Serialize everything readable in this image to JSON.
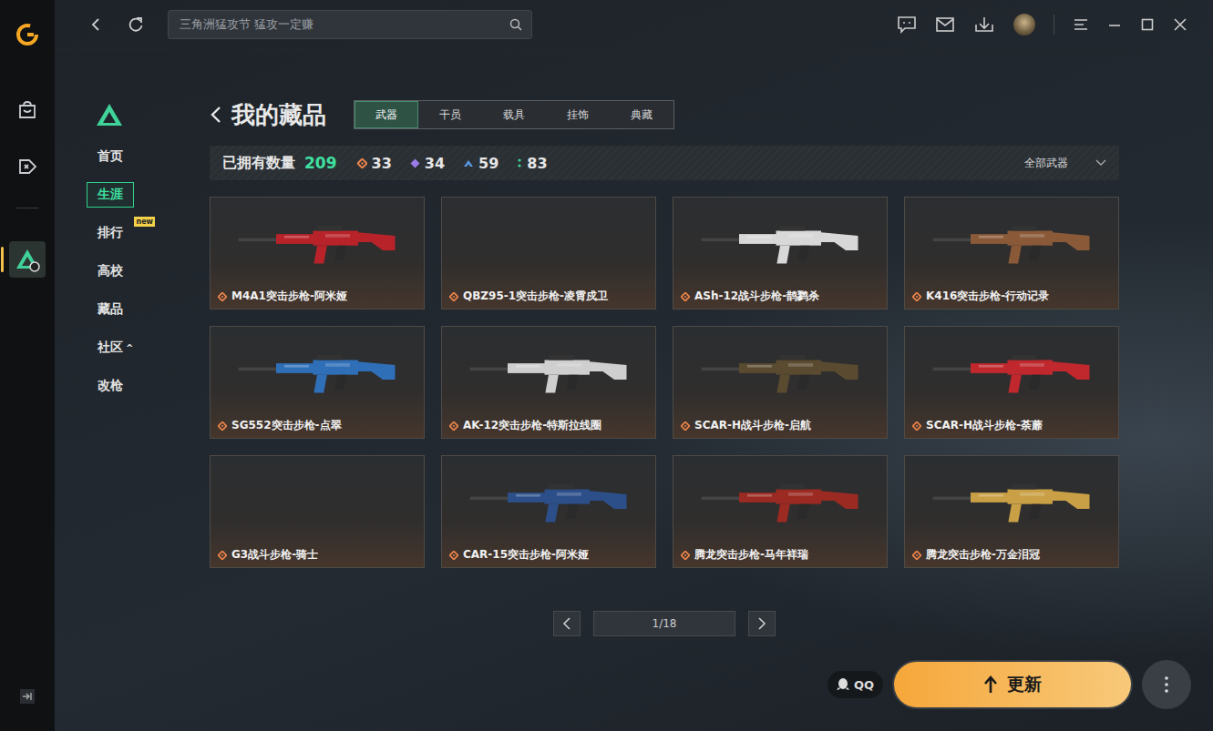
{
  "search": {
    "placeholder": "三角洲猛攻节 猛攻一定赚"
  },
  "subnav": [
    {
      "label": "首页",
      "selected": false
    },
    {
      "label": "生涯",
      "selected": true
    },
    {
      "label": "排行",
      "selected": false,
      "badge": "new"
    },
    {
      "label": "高校",
      "selected": false
    },
    {
      "label": "藏品",
      "selected": false
    },
    {
      "label": "社区",
      "selected": false,
      "suffix": "^"
    },
    {
      "label": "改枪",
      "selected": false
    }
  ],
  "page_title": "我的藏品",
  "tabs": [
    {
      "label": "武器",
      "selected": true
    },
    {
      "label": "干员",
      "selected": false
    },
    {
      "label": "载具",
      "selected": false
    },
    {
      "label": "挂饰",
      "selected": false
    },
    {
      "label": "典藏",
      "selected": false
    }
  ],
  "stats": {
    "label": "已拥有数量",
    "total": "209",
    "rarities": [
      {
        "kind": "diamond",
        "count": "33",
        "color": "#e8834a"
      },
      {
        "kind": "gem",
        "count": "34",
        "color": "#9b7be8"
      },
      {
        "kind": "chevron",
        "count": "59",
        "color": "#5b9be8"
      },
      {
        "kind": "dots",
        "count": "83",
        "color": "#3fd39a"
      }
    ]
  },
  "filter": {
    "label": "全部武器"
  },
  "items": [
    {
      "name": "M4A1突击步枪-阿米娅",
      "image": true,
      "color": "#b8232a"
    },
    {
      "name": "QBZ95-1突击步枪-凌霄戍卫",
      "image": false,
      "color": "#555555"
    },
    {
      "name": "ASh-12战斗步枪-鹊鹨杀",
      "image": true,
      "color": "#d8d8d8"
    },
    {
      "name": "K416突击步枪-行动记录",
      "image": true,
      "color": "#8a5a38"
    },
    {
      "name": "SG552突击步枪-点翠",
      "image": true,
      "color": "#2f6fb8"
    },
    {
      "name": "AK-12突击步枪-特斯拉线圈",
      "image": true,
      "color": "#cfcfcf"
    },
    {
      "name": "SCAR-H战斗步枪-启航",
      "image": true,
      "color": "#5a4a30"
    },
    {
      "name": "SCAR-H战斗步枪-荼蘼",
      "image": true,
      "color": "#c0282e"
    },
    {
      "name": "G3战斗步枪-骑士",
      "image": false,
      "color": "#555555"
    },
    {
      "name": "CAR-15突击步枪-阿米娅",
      "image": true,
      "color": "#2c4f8a"
    },
    {
      "name": "腾龙突击步枪-马年祥瑞",
      "image": true,
      "color": "#9a2a22"
    },
    {
      "name": "腾龙突击步枪-万金泪冠",
      "image": true,
      "color": "#c9a045"
    }
  ],
  "rarity_color": "#e8834a",
  "pagination": {
    "page": "1/18"
  },
  "qq": {
    "label": "QQ"
  },
  "update_button": {
    "label": "更新"
  }
}
